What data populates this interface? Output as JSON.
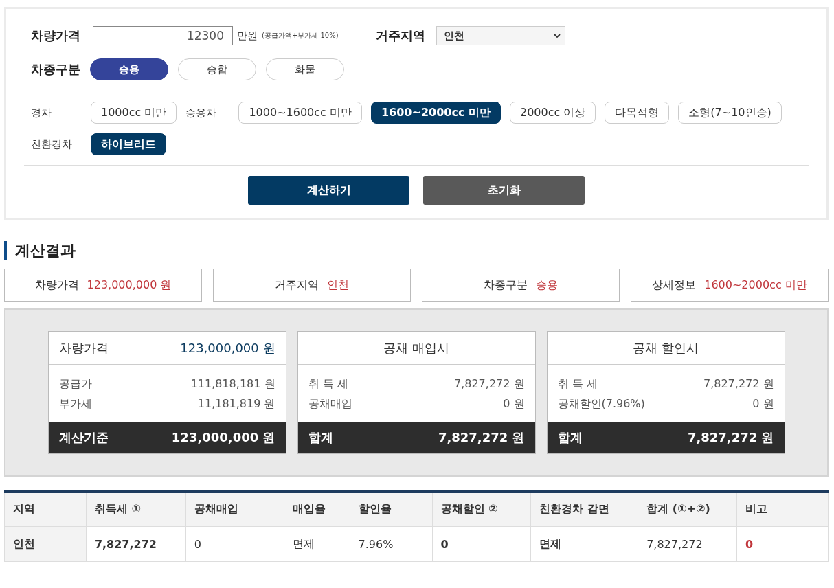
{
  "form": {
    "price": {
      "label": "차량가격",
      "value": "12300",
      "unit": "만원",
      "note": "(공급가액+부가세 10%)"
    },
    "region": {
      "label": "거주지역",
      "value": "인천"
    },
    "vehicle_type": {
      "label": "차종구분",
      "options": [
        {
          "label": "승용",
          "selected": true
        },
        {
          "label": "승합",
          "selected": false
        },
        {
          "label": "화물",
          "selected": false
        }
      ]
    },
    "detail_rows": [
      {
        "groups": [
          {
            "label": "경차",
            "options": [
              {
                "label": "1000cc 미만",
                "selected": false
              }
            ]
          },
          {
            "label": "승용차",
            "options": [
              {
                "label": "1000~1600cc 미만",
                "selected": false
              },
              {
                "label": "1600~2000cc 미만",
                "selected": true
              },
              {
                "label": "2000cc 이상",
                "selected": false
              },
              {
                "label": "다목적형",
                "selected": false
              },
              {
                "label": "소형(7~10인승)",
                "selected": false
              }
            ]
          }
        ]
      },
      {
        "groups": [
          {
            "label": "친환경차",
            "options": [
              {
                "label": "하이브리드",
                "selected": true
              }
            ]
          }
        ]
      }
    ],
    "buttons": [
      {
        "label": "계산하기",
        "kind": "primary"
      },
      {
        "label": "초기화",
        "kind": "secondary"
      }
    ]
  },
  "result": {
    "title": "계산결과",
    "summary": [
      {
        "label": "차량가격",
        "value": "123,000,000 원"
      },
      {
        "label": "거주지역",
        "value": "인천"
      },
      {
        "label": "차종구분",
        "value": "승용"
      },
      {
        "label": "상세정보",
        "value": "1600~2000cc 미만"
      }
    ],
    "cards": [
      {
        "kind": "price",
        "header": {
          "label": "차량가격",
          "value": "123,000,000 원"
        },
        "lines": [
          {
            "label": "공급가",
            "value": "111,818,181 원"
          },
          {
            "label": "부가세",
            "value": "11,181,819 원"
          }
        ],
        "total": {
          "label": "계산기준",
          "value": "123,000,000 원"
        }
      },
      {
        "kind": "title",
        "header": {
          "label": "공채 매입시"
        },
        "lines": [
          {
            "label": "취 득 세",
            "value": "7,827,272 원"
          },
          {
            "label": "공채매입",
            "value": "0 원"
          }
        ],
        "total": {
          "label": "합계",
          "value": "7,827,272 원"
        }
      },
      {
        "kind": "title",
        "header": {
          "label": "공채 할인시"
        },
        "lines": [
          {
            "label": "취 득 세",
            "value": "7,827,272 원"
          },
          {
            "label": "공채할인(7.96%)",
            "value": "0 원"
          }
        ],
        "total": {
          "label": "합계",
          "value": "7,827,272 원"
        }
      }
    ],
    "table": {
      "columns": [
        "지역",
        "취득세 ①",
        "공채매입",
        "매입율",
        "할인율",
        "공채할인 ②",
        "친환경차 감면",
        "합계 (①+②)",
        "비고"
      ],
      "rows": [
        [
          {
            "text": "인천",
            "kind": "bold"
          },
          {
            "text": "7,827,272",
            "kind": "bold"
          },
          {
            "text": "0",
            "kind": "plain"
          },
          {
            "text": "면제",
            "kind": "plain"
          },
          {
            "text": "7.96%",
            "kind": "plain"
          },
          {
            "text": "0",
            "kind": "bold"
          },
          {
            "text": "면제",
            "kind": "bold"
          },
          {
            "text": "7,827,272",
            "kind": "plain"
          },
          {
            "text": "0",
            "kind": "alert"
          }
        ]
      ]
    }
  }
}
